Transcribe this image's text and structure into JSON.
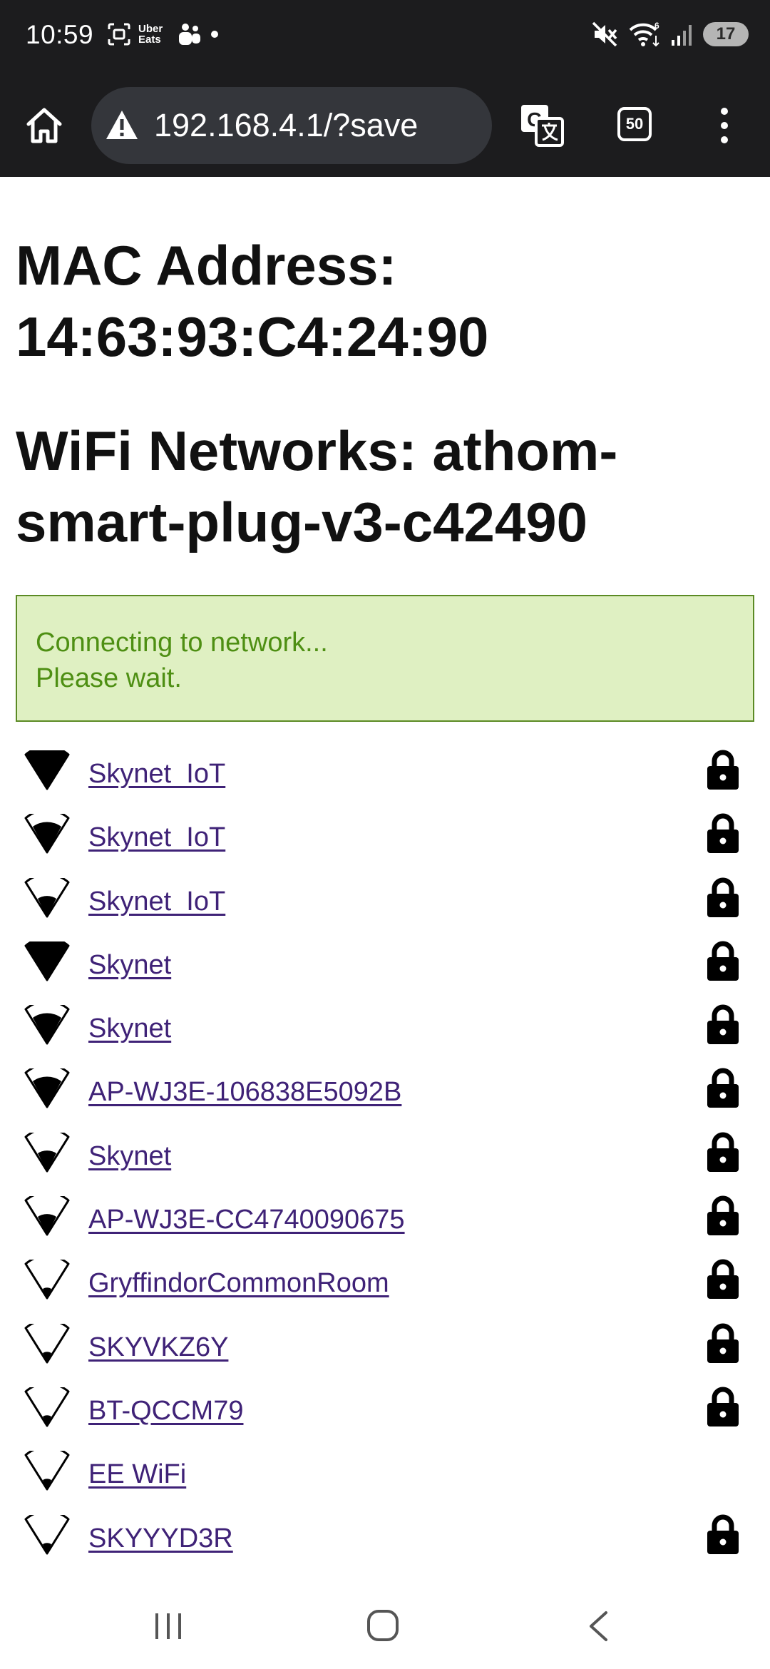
{
  "status_bar": {
    "time": "10:59",
    "left_icons": [
      "screenshot-icon",
      "uber-eats-icon",
      "teams-icon",
      "dot-icon"
    ],
    "uber_eats_label": "Uber\nEats",
    "right_icons": [
      "mute-icon",
      "wifi-6-icon",
      "cell-signal-icon"
    ],
    "wifi_badge": "6",
    "battery": "17"
  },
  "toolbar": {
    "url": "192.168.4.1/?save",
    "tab_count": "50",
    "icons": [
      "home-icon",
      "warning-icon",
      "translate-icon",
      "tabs-icon",
      "more-vert-icon"
    ]
  },
  "page": {
    "mac_heading": "MAC Address: 14:63:93:C4:24:90",
    "wifi_heading": "WiFi Networks: athom-smart-plug-v3-c42490",
    "notice_line1": "Connecting to network...",
    "notice_line2": "Please wait.",
    "notice_colors": {
      "background": "#dff0c2",
      "border": "#5b8a24",
      "text": "#4e8f13"
    },
    "link_color": "#3f2277",
    "networks": [
      {
        "ssid": "Skynet_IoT",
        "signal": 4,
        "locked": true
      },
      {
        "ssid": "Skynet_IoT",
        "signal": 3,
        "locked": true
      },
      {
        "ssid": "Skynet_IoT",
        "signal": 2,
        "locked": true
      },
      {
        "ssid": "Skynet",
        "signal": 4,
        "locked": true
      },
      {
        "ssid": "Skynet",
        "signal": 3,
        "locked": true
      },
      {
        "ssid": "AP-WJ3E-106838E5092B",
        "signal": 3,
        "locked": true
      },
      {
        "ssid": "Skynet",
        "signal": 2,
        "locked": true
      },
      {
        "ssid": "AP-WJ3E-CC4740090675",
        "signal": 2,
        "locked": true
      },
      {
        "ssid": "GryffindorCommonRoom",
        "signal": 1,
        "locked": true
      },
      {
        "ssid": "SKYVKZ6Y",
        "signal": 1,
        "locked": true
      },
      {
        "ssid": "BT-QCCM79",
        "signal": 1,
        "locked": true
      },
      {
        "ssid": "EE WiFi",
        "signal": 1,
        "locked": false
      },
      {
        "ssid": "SKYYYD3R",
        "signal": 1,
        "locked": true
      }
    ]
  },
  "nav_bar": {
    "icons": [
      "recents-icon",
      "home-circle-icon",
      "back-icon"
    ]
  }
}
